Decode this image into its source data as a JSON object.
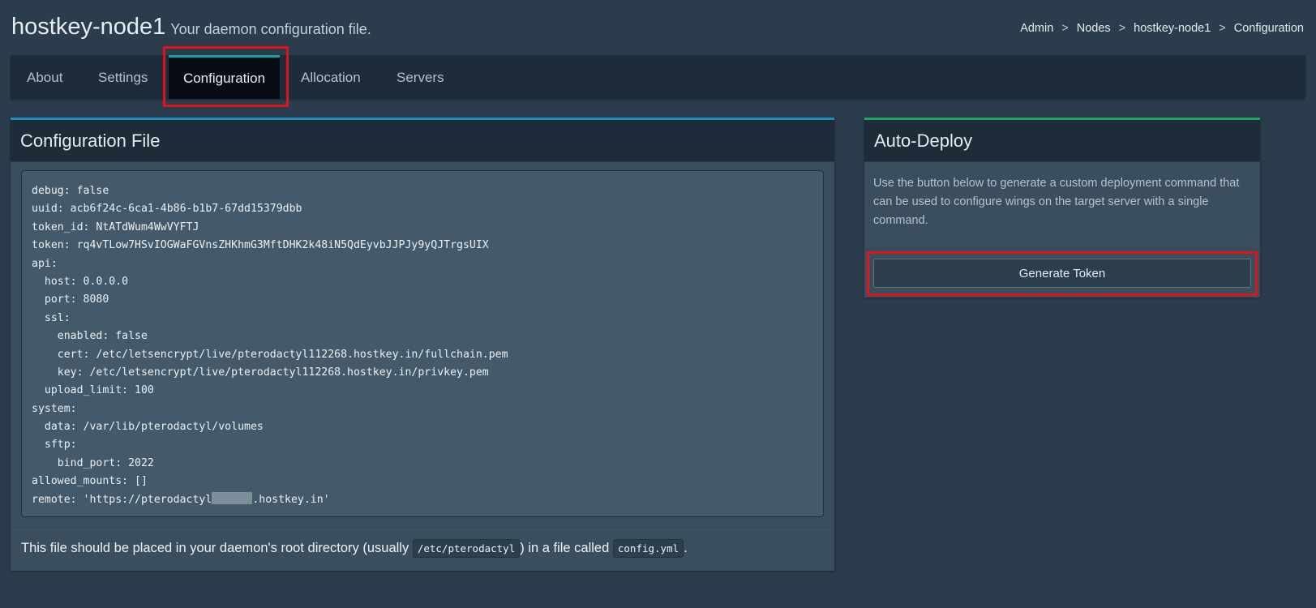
{
  "header": {
    "title": "hostkey-node1",
    "subtitle": "Your daemon configuration file.",
    "breadcrumb": [
      "Admin",
      "Nodes",
      "hostkey-node1",
      "Configuration"
    ],
    "breadcrumb_separator": ">"
  },
  "tabs": [
    {
      "label": "About",
      "active": false
    },
    {
      "label": "Settings",
      "active": false
    },
    {
      "label": "Configuration",
      "active": true
    },
    {
      "label": "Allocation",
      "active": false
    },
    {
      "label": "Servers",
      "active": false
    }
  ],
  "config_panel": {
    "title": "Configuration File",
    "code_lines": [
      "debug: false",
      "uuid: acb6f24c-6ca1-4b86-b1b7-67dd15379dbb",
      "token_id: NtATdWum4WwVYFTJ",
      "token: rq4vTLow7HSvIOGWaFGVnsZHKhmG3MftDHK2k48iN5QdEyvbJJPJy9yQJTrgsUIX",
      "api:",
      "  host: 0.0.0.0",
      "  port: 8080",
      "  ssl:",
      "    enabled: false",
      "    cert: /etc/letsencrypt/live/pterodactyl112268.hostkey.in/fullchain.pem",
      "    key: /etc/letsencrypt/live/pterodactyl112268.hostkey.in/privkey.pem",
      "  upload_limit: 100",
      "system:",
      "  data: /var/lib/pterodactyl/volumes",
      "  sftp:",
      "    bind_port: 2022",
      "allowed_mounts: []"
    ],
    "remote_prefix": "remote: 'https://pterodactyl",
    "remote_suffix": ".hostkey.in'",
    "footer": {
      "text_1": "This file should be placed in your daemon's root directory (usually ",
      "code_1": "/etc/pterodactyl",
      "text_2": ") in a file called ",
      "code_2": "config.yml",
      "text_3": "."
    }
  },
  "deploy_panel": {
    "title": "Auto-Deploy",
    "description": "Use the button below to generate a custom deployment command that can be used to configure wings on the target server with a single command.",
    "button_label": "Generate Token"
  },
  "colors": {
    "highlight": "#e0121b",
    "config_accent": "#1c8fc0",
    "deploy_accent": "#18a95b",
    "tab_active_accent": "#0fa3a8"
  }
}
